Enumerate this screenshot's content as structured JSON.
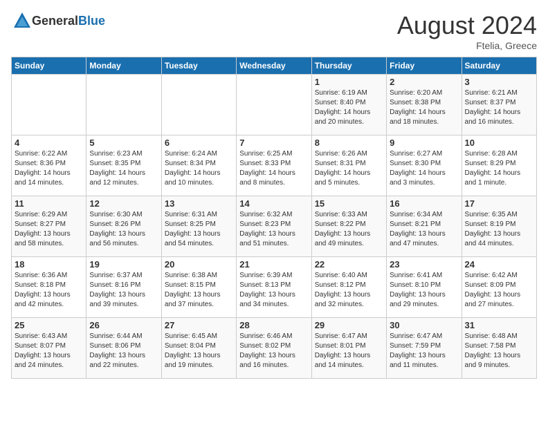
{
  "header": {
    "logo_general": "General",
    "logo_blue": "Blue",
    "month_year": "August 2024",
    "location": "Ftelia, Greece"
  },
  "days_of_week": [
    "Sunday",
    "Monday",
    "Tuesday",
    "Wednesday",
    "Thursday",
    "Friday",
    "Saturday"
  ],
  "weeks": [
    [
      {
        "day": "",
        "info": ""
      },
      {
        "day": "",
        "info": ""
      },
      {
        "day": "",
        "info": ""
      },
      {
        "day": "",
        "info": ""
      },
      {
        "day": "1",
        "info": "Sunrise: 6:19 AM\nSunset: 8:40 PM\nDaylight: 14 hours\nand 20 minutes."
      },
      {
        "day": "2",
        "info": "Sunrise: 6:20 AM\nSunset: 8:38 PM\nDaylight: 14 hours\nand 18 minutes."
      },
      {
        "day": "3",
        "info": "Sunrise: 6:21 AM\nSunset: 8:37 PM\nDaylight: 14 hours\nand 16 minutes."
      }
    ],
    [
      {
        "day": "4",
        "info": "Sunrise: 6:22 AM\nSunset: 8:36 PM\nDaylight: 14 hours\nand 14 minutes."
      },
      {
        "day": "5",
        "info": "Sunrise: 6:23 AM\nSunset: 8:35 PM\nDaylight: 14 hours\nand 12 minutes."
      },
      {
        "day": "6",
        "info": "Sunrise: 6:24 AM\nSunset: 8:34 PM\nDaylight: 14 hours\nand 10 minutes."
      },
      {
        "day": "7",
        "info": "Sunrise: 6:25 AM\nSunset: 8:33 PM\nDaylight: 14 hours\nand 8 minutes."
      },
      {
        "day": "8",
        "info": "Sunrise: 6:26 AM\nSunset: 8:31 PM\nDaylight: 14 hours\nand 5 minutes."
      },
      {
        "day": "9",
        "info": "Sunrise: 6:27 AM\nSunset: 8:30 PM\nDaylight: 14 hours\nand 3 minutes."
      },
      {
        "day": "10",
        "info": "Sunrise: 6:28 AM\nSunset: 8:29 PM\nDaylight: 14 hours\nand 1 minute."
      }
    ],
    [
      {
        "day": "11",
        "info": "Sunrise: 6:29 AM\nSunset: 8:27 PM\nDaylight: 13 hours\nand 58 minutes."
      },
      {
        "day": "12",
        "info": "Sunrise: 6:30 AM\nSunset: 8:26 PM\nDaylight: 13 hours\nand 56 minutes."
      },
      {
        "day": "13",
        "info": "Sunrise: 6:31 AM\nSunset: 8:25 PM\nDaylight: 13 hours\nand 54 minutes."
      },
      {
        "day": "14",
        "info": "Sunrise: 6:32 AM\nSunset: 8:23 PM\nDaylight: 13 hours\nand 51 minutes."
      },
      {
        "day": "15",
        "info": "Sunrise: 6:33 AM\nSunset: 8:22 PM\nDaylight: 13 hours\nand 49 minutes."
      },
      {
        "day": "16",
        "info": "Sunrise: 6:34 AM\nSunset: 8:21 PM\nDaylight: 13 hours\nand 47 minutes."
      },
      {
        "day": "17",
        "info": "Sunrise: 6:35 AM\nSunset: 8:19 PM\nDaylight: 13 hours\nand 44 minutes."
      }
    ],
    [
      {
        "day": "18",
        "info": "Sunrise: 6:36 AM\nSunset: 8:18 PM\nDaylight: 13 hours\nand 42 minutes."
      },
      {
        "day": "19",
        "info": "Sunrise: 6:37 AM\nSunset: 8:16 PM\nDaylight: 13 hours\nand 39 minutes."
      },
      {
        "day": "20",
        "info": "Sunrise: 6:38 AM\nSunset: 8:15 PM\nDaylight: 13 hours\nand 37 minutes."
      },
      {
        "day": "21",
        "info": "Sunrise: 6:39 AM\nSunset: 8:13 PM\nDaylight: 13 hours\nand 34 minutes."
      },
      {
        "day": "22",
        "info": "Sunrise: 6:40 AM\nSunset: 8:12 PM\nDaylight: 13 hours\nand 32 minutes."
      },
      {
        "day": "23",
        "info": "Sunrise: 6:41 AM\nSunset: 8:10 PM\nDaylight: 13 hours\nand 29 minutes."
      },
      {
        "day": "24",
        "info": "Sunrise: 6:42 AM\nSunset: 8:09 PM\nDaylight: 13 hours\nand 27 minutes."
      }
    ],
    [
      {
        "day": "25",
        "info": "Sunrise: 6:43 AM\nSunset: 8:07 PM\nDaylight: 13 hours\nand 24 minutes."
      },
      {
        "day": "26",
        "info": "Sunrise: 6:44 AM\nSunset: 8:06 PM\nDaylight: 13 hours\nand 22 minutes."
      },
      {
        "day": "27",
        "info": "Sunrise: 6:45 AM\nSunset: 8:04 PM\nDaylight: 13 hours\nand 19 minutes."
      },
      {
        "day": "28",
        "info": "Sunrise: 6:46 AM\nSunset: 8:02 PM\nDaylight: 13 hours\nand 16 minutes."
      },
      {
        "day": "29",
        "info": "Sunrise: 6:47 AM\nSunset: 8:01 PM\nDaylight: 13 hours\nand 14 minutes."
      },
      {
        "day": "30",
        "info": "Sunrise: 6:47 AM\nSunset: 7:59 PM\nDaylight: 13 hours\nand 11 minutes."
      },
      {
        "day": "31",
        "info": "Sunrise: 6:48 AM\nSunset: 7:58 PM\nDaylight: 13 hours\nand 9 minutes."
      }
    ]
  ]
}
